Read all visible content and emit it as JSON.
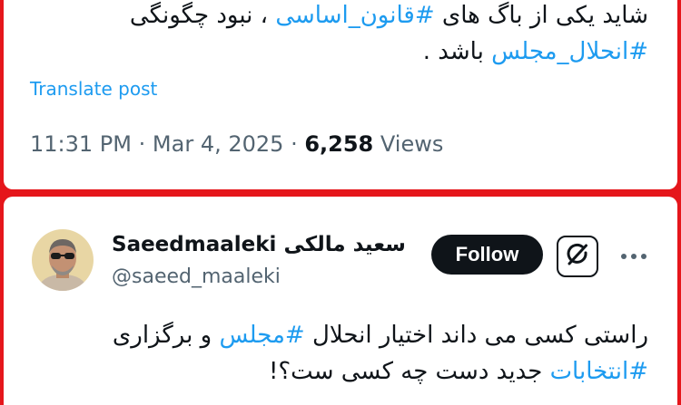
{
  "first_post": {
    "line1": {
      "text_before": "شاید یکی از باگ های ",
      "hashtag": "#قانون_اساسی",
      "text_after": " ، نبود چگونگی"
    },
    "line2": {
      "hashtag": "#انحلال_مجلس",
      "text_after": " باشد ."
    },
    "translate_label": "Translate post",
    "time": "11:31 PM",
    "date": "Mar 4, 2025",
    "views_count": "6,258",
    "views_label": "Views",
    "separator": "·"
  },
  "second_post": {
    "author": {
      "display_name": "Saeedmaaleki سعید مالکی",
      "handle": "@saeed_maaleki"
    },
    "follow_label": "Follow",
    "grok_icon": "grok-icon",
    "more_icon": "more-icon",
    "line1": {
      "text_before": "راستی کسی می داند اختیار انحلال ",
      "hashtag": "#مجلس",
      "text_after": " و برگزاری"
    },
    "line2": {
      "hashtag": "#انتخابات",
      "text_after": " جدید دست چه کسی ست؟!"
    }
  },
  "colors": {
    "frame": "#e5161b",
    "link": "#1d9bf0",
    "text": "#0f1419",
    "muted": "#536471"
  }
}
